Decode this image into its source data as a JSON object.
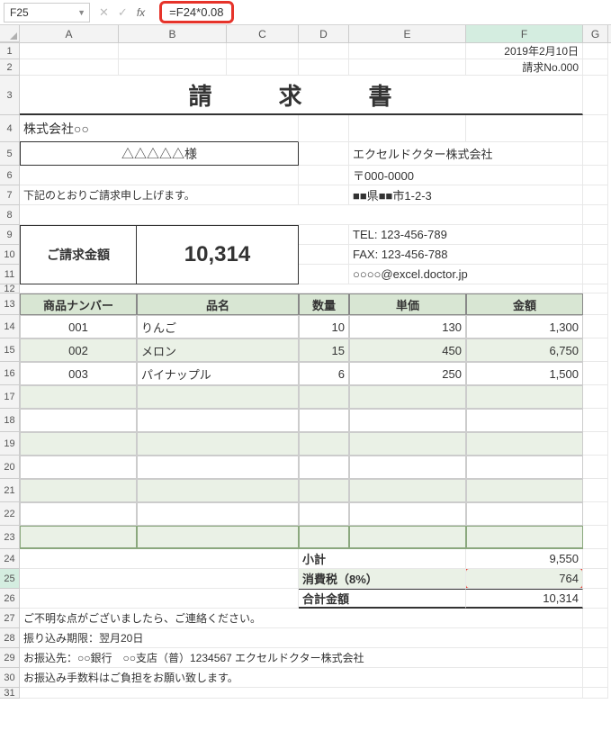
{
  "formula_bar": {
    "name_box": "F25",
    "formula": "=F24*0.08"
  },
  "col_headers": [
    "A",
    "B",
    "C",
    "D",
    "E",
    "F",
    "G"
  ],
  "row_headers": [
    "1",
    "2",
    "3",
    "4",
    "5",
    "6",
    "7",
    "8",
    "9",
    "10",
    "11",
    "12",
    "13",
    "14",
    "15",
    "16",
    "17",
    "18",
    "19",
    "20",
    "21",
    "22",
    "23",
    "24",
    "25",
    "26",
    "27",
    "28",
    "29",
    "30",
    "31"
  ],
  "doc": {
    "date": "2019年2月10日",
    "invoice_no": "請求No.000",
    "title": "請　求　書",
    "company": "株式会社○○",
    "customer": "△△△△△様",
    "message": "下記のとおりご請求申し上げます。",
    "total_label": "ご請求金額",
    "total_amount": "10,314",
    "sender": {
      "name": "エクセルドクター株式会社",
      "postal": "〒000-0000",
      "address": "■■県■■市1-2-3",
      "tel": "TEL: 123-456-789",
      "fax": "FAX: 123-456-788",
      "email": "○○○○@excel.doctor.jp"
    },
    "table": {
      "headers": {
        "no": "商品ナンバー",
        "name": "品名",
        "qty": "数量",
        "price": "単価",
        "amount": "金額"
      },
      "rows": [
        {
          "no": "001",
          "name": "りんご",
          "qty": "10",
          "price": "130",
          "amount": "1,300"
        },
        {
          "no": "002",
          "name": "メロン",
          "qty": "15",
          "price": "450",
          "amount": "6,750"
        },
        {
          "no": "003",
          "name": "パイナップル",
          "qty": "6",
          "price": "250",
          "amount": "1,500"
        }
      ],
      "subtotal_label": "小計",
      "subtotal": "9,550",
      "tax_label": "消費税（8%）",
      "tax": "764",
      "grand_label": "合計金額",
      "grand": "10,314"
    },
    "notes": {
      "n1": "ご不明な点がございましたら、ご連絡ください。",
      "n2": "振り込み期限：翌月20日",
      "n3": "お振込先：○○銀行　○○支店（普）1234567 エクセルドクター株式会社",
      "n4": "お振込み手数料はご負担をお願い致します。"
    }
  }
}
